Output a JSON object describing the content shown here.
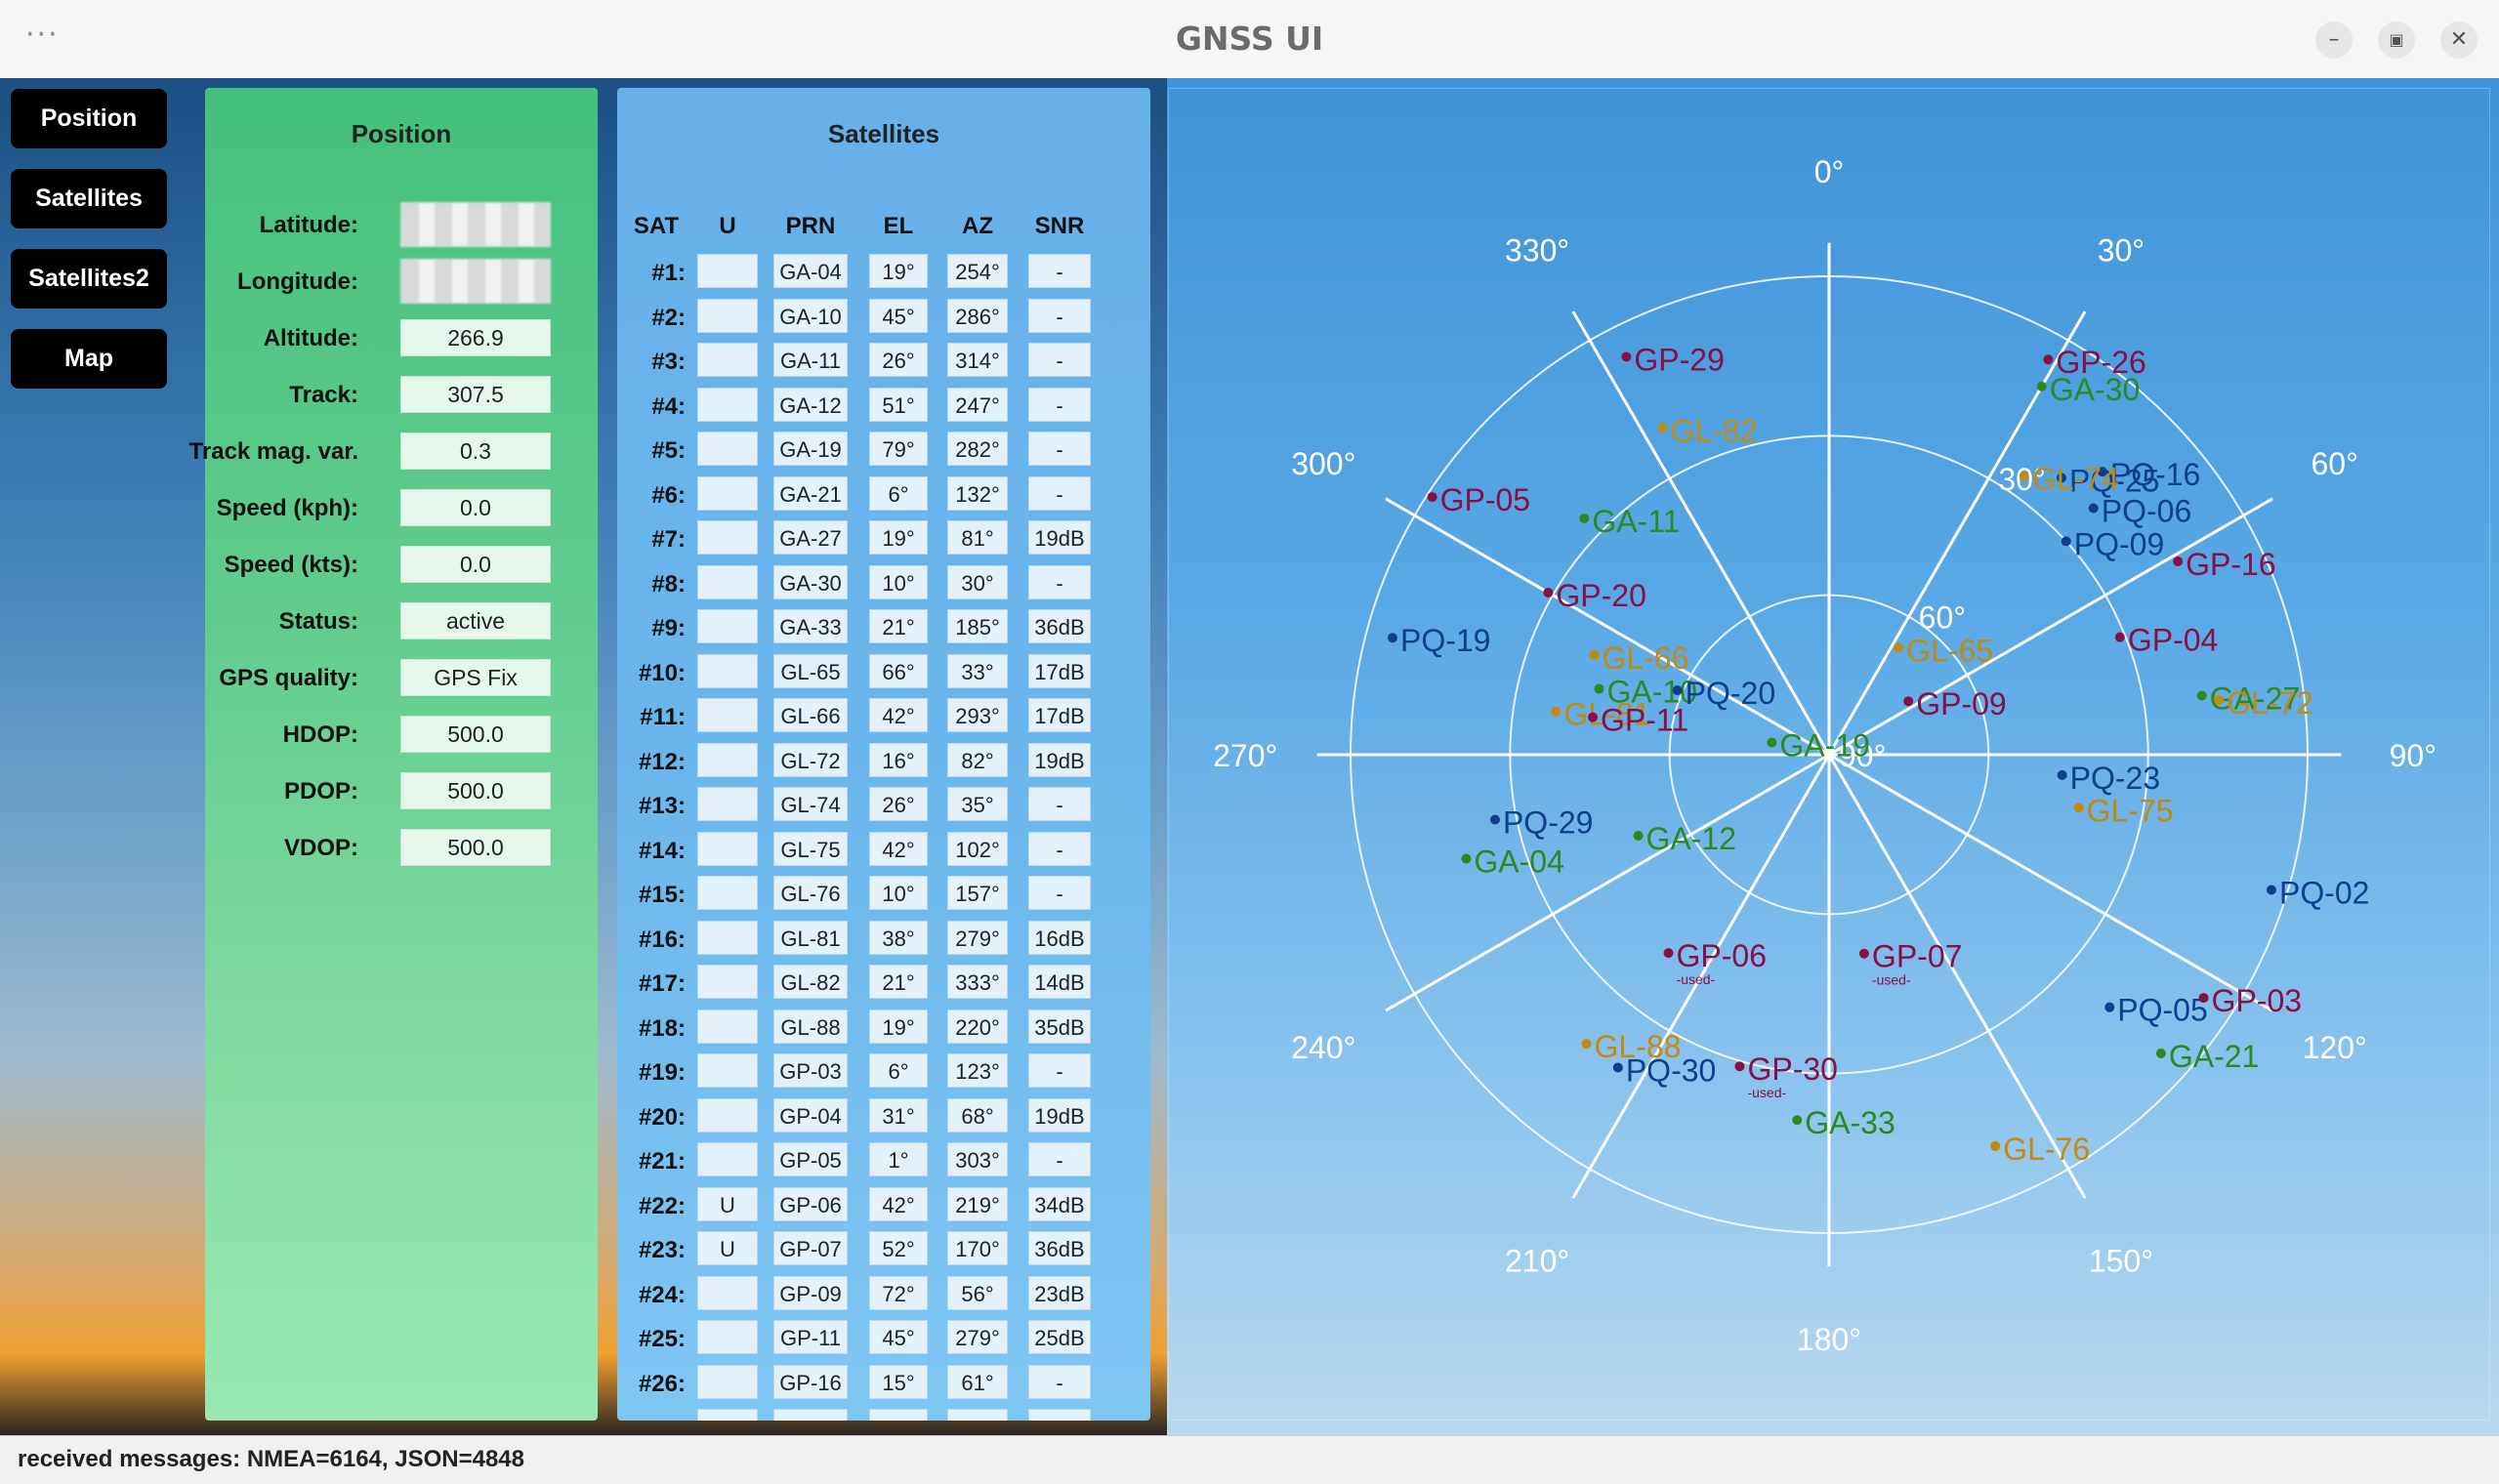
{
  "window": {
    "title": "GNSS UI",
    "menu_icon": "more-dots-icon"
  },
  "nav": [
    {
      "label": "Position"
    },
    {
      "label": "Satellites"
    },
    {
      "label": "Satellites2"
    },
    {
      "label": "Map"
    }
  ],
  "position": {
    "title": "Position",
    "rows": [
      {
        "label": "Latitude:",
        "value": "",
        "redacted": true
      },
      {
        "label": "Longitude:",
        "value": "",
        "redacted": true
      },
      {
        "label": "Altitude:",
        "value": "266.9"
      },
      {
        "label": "Track:",
        "value": "307.5"
      },
      {
        "label": "Track mag. var.",
        "value": "0.3"
      },
      {
        "label": "Speed (kph):",
        "value": "0.0"
      },
      {
        "label": "Speed (kts):",
        "value": "0.0"
      },
      {
        "label": "Status:",
        "value": "active"
      },
      {
        "label": "GPS quality:",
        "value": "GPS Fix"
      },
      {
        "label": "HDOP:",
        "value": "500.0"
      },
      {
        "label": "PDOP:",
        "value": "500.0"
      },
      {
        "label": "VDOP:",
        "value": "500.0"
      }
    ]
  },
  "satellites": {
    "title": "Satellites",
    "headers": [
      "SAT",
      "U",
      "PRN",
      "EL",
      "AZ",
      "SNR"
    ],
    "rows": [
      {
        "num": "#1:",
        "u": "",
        "prn": "GA-04",
        "el": "19°",
        "az": "254°",
        "snr": "-"
      },
      {
        "num": "#2:",
        "u": "",
        "prn": "GA-10",
        "el": "45°",
        "az": "286°",
        "snr": "-"
      },
      {
        "num": "#3:",
        "u": "",
        "prn": "GA-11",
        "el": "26°",
        "az": "314°",
        "snr": "-"
      },
      {
        "num": "#4:",
        "u": "",
        "prn": "GA-12",
        "el": "51°",
        "az": "247°",
        "snr": "-"
      },
      {
        "num": "#5:",
        "u": "",
        "prn": "GA-19",
        "el": "79°",
        "az": "282°",
        "snr": "-"
      },
      {
        "num": "#6:",
        "u": "",
        "prn": "GA-21",
        "el": "6°",
        "az": "132°",
        "snr": "-"
      },
      {
        "num": "#7:",
        "u": "",
        "prn": "GA-27",
        "el": "19°",
        "az": "81°",
        "snr": "19dB"
      },
      {
        "num": "#8:",
        "u": "",
        "prn": "GA-30",
        "el": "10°",
        "az": "30°",
        "snr": "-"
      },
      {
        "num": "#9:",
        "u": "",
        "prn": "GA-33",
        "el": "21°",
        "az": "185°",
        "snr": "36dB"
      },
      {
        "num": "#10:",
        "u": "",
        "prn": "GL-65",
        "el": "66°",
        "az": "33°",
        "snr": "17dB"
      },
      {
        "num": "#11:",
        "u": "",
        "prn": "GL-66",
        "el": "42°",
        "az": "293°",
        "snr": "17dB"
      },
      {
        "num": "#12:",
        "u": "",
        "prn": "GL-72",
        "el": "16°",
        "az": "82°",
        "snr": "19dB"
      },
      {
        "num": "#13:",
        "u": "",
        "prn": "GL-74",
        "el": "26°",
        "az": "35°",
        "snr": "-"
      },
      {
        "num": "#14:",
        "u": "",
        "prn": "GL-75",
        "el": "42°",
        "az": "102°",
        "snr": "-"
      },
      {
        "num": "#15:",
        "u": "",
        "prn": "GL-76",
        "el": "10°",
        "az": "157°",
        "snr": "-"
      },
      {
        "num": "#16:",
        "u": "",
        "prn": "GL-81",
        "el": "38°",
        "az": "279°",
        "snr": "16dB"
      },
      {
        "num": "#17:",
        "u": "",
        "prn": "GL-82",
        "el": "21°",
        "az": "333°",
        "snr": "14dB"
      },
      {
        "num": "#18:",
        "u": "",
        "prn": "GL-88",
        "el": "19°",
        "az": "220°",
        "snr": "35dB"
      },
      {
        "num": "#19:",
        "u": "",
        "prn": "GP-03",
        "el": "6°",
        "az": "123°",
        "snr": "-"
      },
      {
        "num": "#20:",
        "u": "",
        "prn": "GP-04",
        "el": "31°",
        "az": "68°",
        "snr": "19dB"
      },
      {
        "num": "#21:",
        "u": "",
        "prn": "GP-05",
        "el": "1°",
        "az": "303°",
        "snr": "-"
      },
      {
        "num": "#22:",
        "u": "U",
        "prn": "GP-06",
        "el": "42°",
        "az": "219°",
        "snr": "34dB"
      },
      {
        "num": "#23:",
        "u": "U",
        "prn": "GP-07",
        "el": "52°",
        "az": "170°",
        "snr": "36dB"
      },
      {
        "num": "#24:",
        "u": "",
        "prn": "GP-09",
        "el": "72°",
        "az": "56°",
        "snr": "23dB"
      },
      {
        "num": "#25:",
        "u": "",
        "prn": "GP-11",
        "el": "45°",
        "az": "279°",
        "snr": "25dB"
      },
      {
        "num": "#26:",
        "u": "",
        "prn": "GP-16",
        "el": "15°",
        "az": "61°",
        "snr": "-"
      }
    ]
  },
  "skyplot": {
    "azimuth_labels": [
      "0°",
      "30°",
      "60°",
      "90°",
      "120°",
      "150°",
      "180°",
      "210°",
      "240°",
      "270°",
      "300°",
      "330°"
    ],
    "elevation_labels": [
      "30°",
      "60°",
      "90°"
    ],
    "used_tag": "-used-",
    "colors": {
      "GA": "#2a8a1e",
      "GL": "#c48a10",
      "GP": "#8a0f46",
      "PQ": "#0f3f8c"
    },
    "satellites": [
      {
        "name": "GP-29",
        "az": 333,
        "el": 6,
        "sys": "GP"
      },
      {
        "name": "GP-26",
        "az": 29,
        "el": 5,
        "sys": "GP"
      },
      {
        "name": "GA-30",
        "az": 30,
        "el": 10,
        "sys": "GA"
      },
      {
        "name": "GL-82",
        "az": 333,
        "el": 21,
        "sys": "GL"
      },
      {
        "name": "PQ-16",
        "az": 44,
        "el": 16,
        "sys": "PQ"
      },
      {
        "name": "PQ-25",
        "az": 40,
        "el": 22,
        "sys": "PQ"
      },
      {
        "name": "PQ-06",
        "az": 47,
        "el": 22,
        "sys": "PQ"
      },
      {
        "name": "GL-74",
        "az": 35,
        "el": 26,
        "sys": "GL"
      },
      {
        "name": "GP-05",
        "az": 303,
        "el": 1,
        "sys": "GP"
      },
      {
        "name": "GA-11",
        "az": 314,
        "el": 26,
        "sys": "GA"
      },
      {
        "name": "PQ-09",
        "az": 48,
        "el": 30,
        "sys": "PQ"
      },
      {
        "name": "GP-16",
        "az": 61,
        "el": 15,
        "sys": "GP"
      },
      {
        "name": "GP-20",
        "az": 300,
        "el": 29,
        "sys": "GP"
      },
      {
        "name": "GL-65",
        "az": 33,
        "el": 66,
        "sys": "GL"
      },
      {
        "name": "GP-04",
        "az": 68,
        "el": 31,
        "sys": "GP"
      },
      {
        "name": "PQ-19",
        "az": 285,
        "el": 5,
        "sys": "PQ"
      },
      {
        "name": "GL-66",
        "az": 293,
        "el": 42,
        "sys": "GL"
      },
      {
        "name": "GA-10",
        "az": 286,
        "el": 45,
        "sys": "GA"
      },
      {
        "name": "PQ-20",
        "az": 293,
        "el": 59,
        "sys": "PQ"
      },
      {
        "name": "GL-81",
        "az": 279,
        "el": 38,
        "sys": "GL"
      },
      {
        "name": "GP-11",
        "az": 279,
        "el": 45,
        "sys": "GP"
      },
      {
        "name": "GP-09",
        "az": 56,
        "el": 72,
        "sys": "GP"
      },
      {
        "name": "GA-27",
        "az": 81,
        "el": 19,
        "sys": "GA"
      },
      {
        "name": "GL-72",
        "az": 82,
        "el": 16,
        "sys": "GL"
      },
      {
        "name": "GA-19",
        "az": 282,
        "el": 79,
        "sys": "GA"
      },
      {
        "name": "PQ-29",
        "az": 259,
        "el": 26,
        "sys": "PQ"
      },
      {
        "name": "PQ-23",
        "az": 95,
        "el": 46,
        "sys": "PQ"
      },
      {
        "name": "GL-75",
        "az": 102,
        "el": 42,
        "sys": "GL"
      },
      {
        "name": "GA-04",
        "az": 254,
        "el": 19,
        "sys": "GA"
      },
      {
        "name": "GA-12",
        "az": 247,
        "el": 51,
        "sys": "GA"
      },
      {
        "name": "PQ-02",
        "az": 107,
        "el": 3,
        "sys": "PQ"
      },
      {
        "name": "GP-06",
        "az": 219,
        "el": 42,
        "sys": "GP",
        "used": true
      },
      {
        "name": "GP-07",
        "az": 170,
        "el": 52,
        "sys": "GP",
        "used": true
      },
      {
        "name": "PQ-05",
        "az": 132,
        "el": 19,
        "sys": "PQ"
      },
      {
        "name": "GP-03",
        "az": 123,
        "el": 6,
        "sys": "GP"
      },
      {
        "name": "GL-88",
        "az": 220,
        "el": 19,
        "sys": "GL"
      },
      {
        "name": "GA-21",
        "az": 132,
        "el": 6,
        "sys": "GA"
      },
      {
        "name": "GP-30",
        "az": 196,
        "el": 29,
        "sys": "GP",
        "used": true
      },
      {
        "name": "GA-33",
        "az": 185,
        "el": 21,
        "sys": "GA"
      },
      {
        "name": "PQ-30",
        "az": 214,
        "el": 19,
        "sys": "PQ"
      },
      {
        "name": "GL-76",
        "az": 157,
        "el": 10,
        "sys": "GL"
      }
    ]
  },
  "status": {
    "text": "received messages: NMEA=6164, JSON=4848"
  }
}
